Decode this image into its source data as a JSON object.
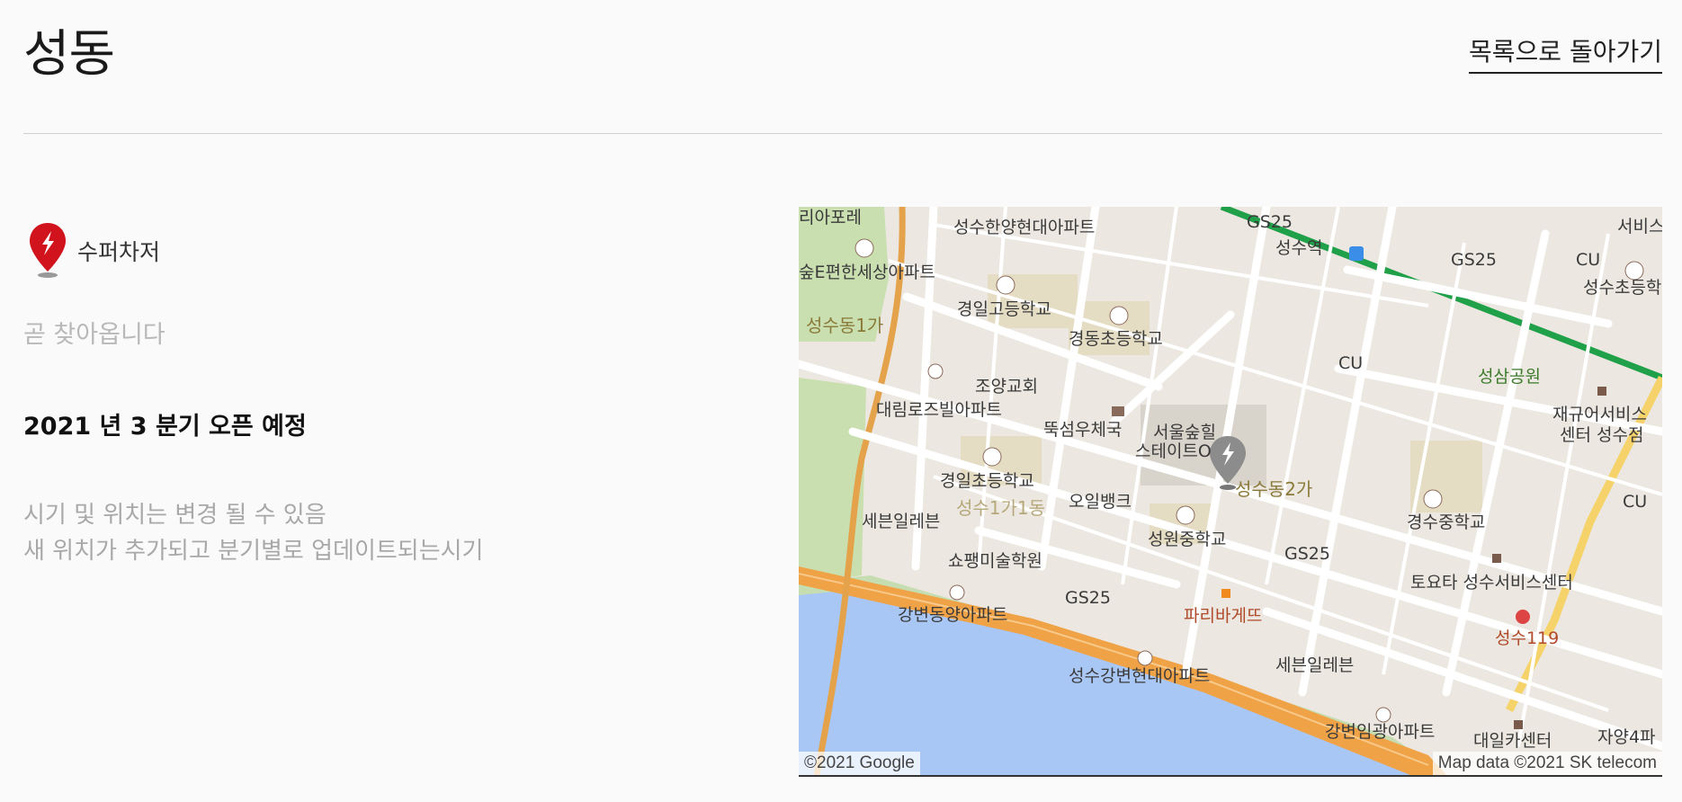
{
  "page": {
    "title": "성동",
    "back_link": "목록으로 돌아가기"
  },
  "location": {
    "charger_type": "수퍼차저",
    "status": "곧 찾아옵니다",
    "open_schedule": "2021 년 3 분기 오픈 예정",
    "notes": [
      "시기 및 위치는 변경 될 수 있음",
      "새 위치가 추가되고 분기별로 업데이트되는시기"
    ]
  },
  "map": {
    "copyright_left": "©2021 Google",
    "copyright_right": "Map data ©2021 SK telecom",
    "labels": {
      "l1": "리아포레",
      "l2": "성수한양현대아파트",
      "l3": "GS25",
      "l4": "성수역",
      "l5": "GS25",
      "l6": "CU",
      "l7": "서비스",
      "l8": "숲E편한세상아파트",
      "l9": "성수초등학",
      "l10": "경일고등학교",
      "l11": "경동초등학교",
      "l12": "성수동1가",
      "l13": "CU",
      "l14": "성삼공원",
      "l15": "조양교회",
      "l16": "대림로즈빌아파트",
      "l17": "재규어서비스",
      "l18": "센터 성수점",
      "l19": "뚝섬우체국",
      "l20": "서울숲힐",
      "l21": "스테이트O",
      "l22": "경일초등학교",
      "l23": "성수동2가",
      "l24": "오일뱅크",
      "l25": "성수1가1동",
      "l26": "CU",
      "l27": "세븐일레븐",
      "l28": "경수중학교",
      "l29": "성원중학교",
      "l30": "GS25",
      "l31": "쇼팽미술학원",
      "l32": "토요타 성수서비스센터",
      "l33": "GS25",
      "l34": "강변동양아파트",
      "l35": "파리바게뜨",
      "l36": "성수119",
      "l37": "세븐일레븐",
      "l38": "성수강변현대아파트",
      "l39": "강변임광아파트",
      "l40": "대일카센터",
      "l41": "자양4파"
    }
  }
}
